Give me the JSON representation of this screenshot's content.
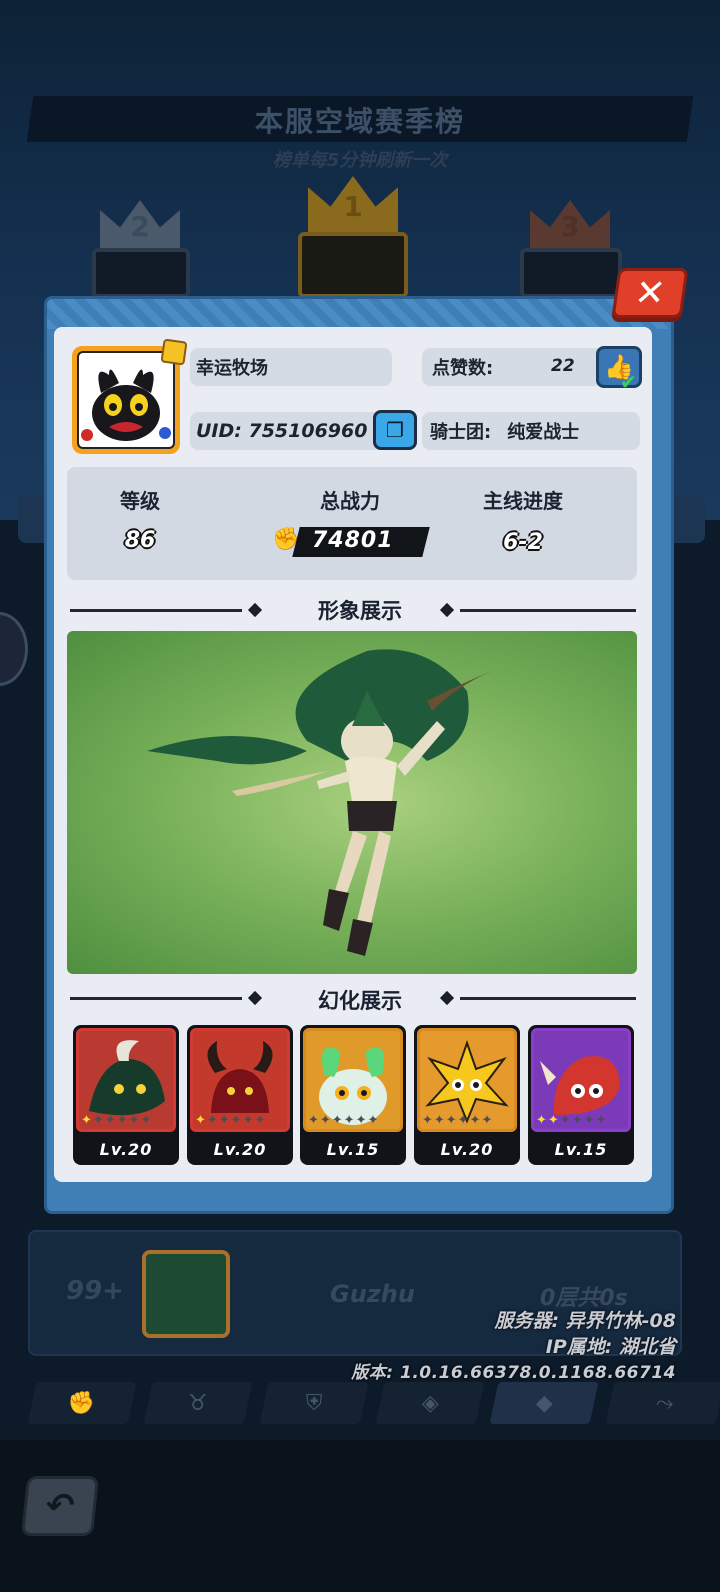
{
  "background": {
    "season_title": "本服空域赛季榜",
    "season_subtitle": "榜单每5分钟刷新一次",
    "podium": [
      {
        "rank": "2"
      },
      {
        "rank": "1"
      },
      {
        "rank": "3"
      }
    ],
    "my_rank": {
      "rank": "99+",
      "name": "Guzhu",
      "progress": "0层共0s"
    },
    "server_info": {
      "server": "服务器: 异界竹林-08",
      "ip": "IP属地: 湖北省",
      "version": "版本: 1.0.16.66378.0.1168.66714"
    },
    "tabs": [
      "fist-icon",
      "bull-icon",
      "shield-icon",
      "chip-icon",
      "gem-icon",
      "share-icon"
    ],
    "active_tab": 4,
    "back_icon": "back-arrow-icon"
  },
  "profile": {
    "name": "幸运牧场",
    "uid": "UID: 755106960",
    "likes_label": "点赞数:",
    "likes": "22",
    "guild_label": "骑士团:",
    "guild": "纯爱战士",
    "stats": {
      "level_label": "等级",
      "level": "86",
      "power_label": "总战力",
      "power": "74801",
      "progress_label": "主线进度",
      "progress": "6-2"
    }
  },
  "sections": {
    "appearance": "形象展示",
    "transform": "幻化展示"
  },
  "skins": [
    {
      "level": "Lv.20",
      "stars": 1,
      "frame_color": "#d23a34",
      "bg": "#b93a30",
      "creature": "dark-dragon"
    },
    {
      "level": "Lv.20",
      "stars": 1,
      "frame_color": "#d23a34",
      "bg": "#c33a2c",
      "creature": "horned-demon"
    },
    {
      "level": "Lv.15",
      "stars": 0,
      "frame_color": "#d88a22",
      "bg": "#e09a2a",
      "creature": "green-owl"
    },
    {
      "level": "Lv.20",
      "stars": 0,
      "frame_color": "#d88a22",
      "bg": "#e49a2c",
      "creature": "yellow-spike"
    },
    {
      "level": "Lv.15",
      "stars": 2,
      "frame_color": "#8b3fc6",
      "bg": "#7b3bb8",
      "creature": "red-dino"
    }
  ],
  "colors": {
    "modal_border": "#3f7fb6",
    "close_button": "#e03f2a",
    "showcase_green": "#7cb35c"
  }
}
